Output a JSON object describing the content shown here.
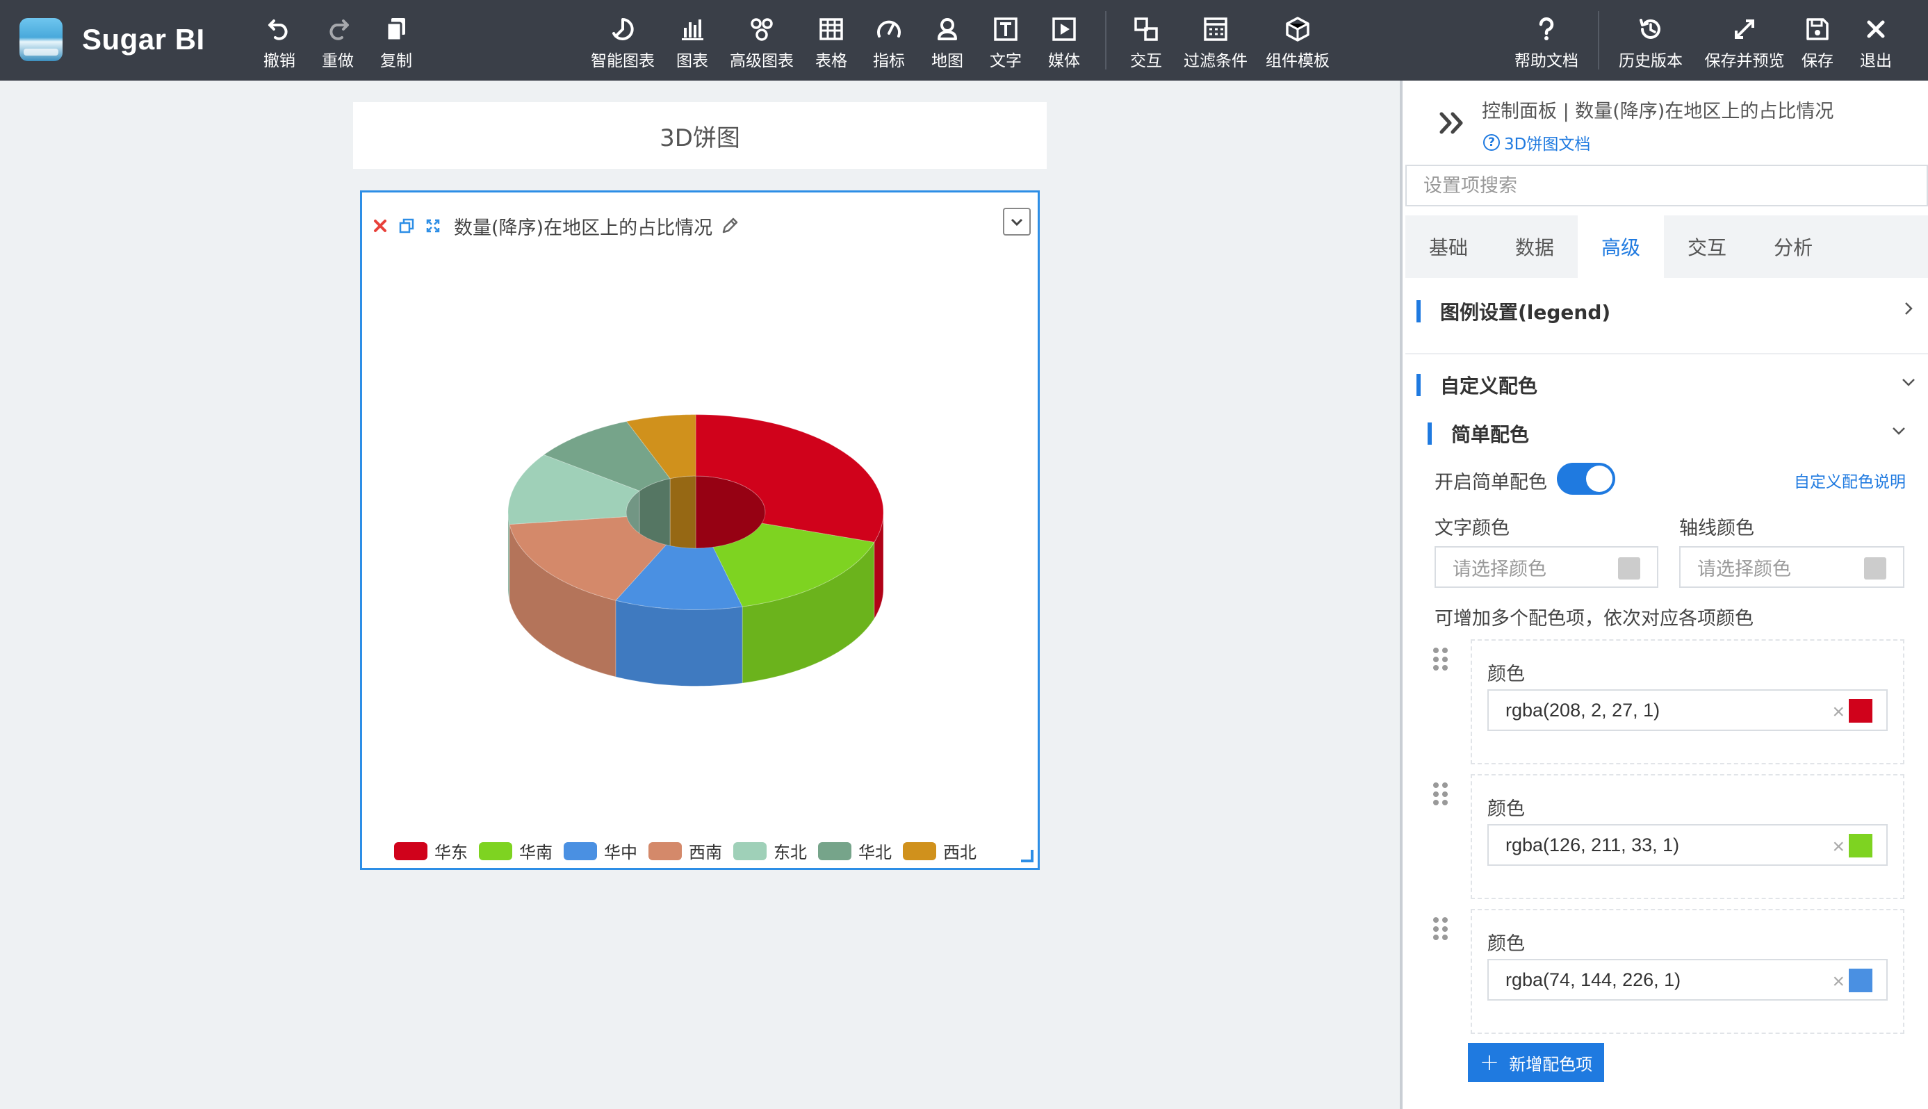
{
  "brand": {
    "name": "Sugar BI"
  },
  "toolbar": {
    "left": [
      {
        "key": "undo",
        "label": "撤销",
        "icon": "undo-icon",
        "disabled": false
      },
      {
        "key": "redo",
        "label": "重做",
        "icon": "redo-icon",
        "disabled": true
      },
      {
        "key": "copy",
        "label": "复制",
        "icon": "copy-icon",
        "disabled": false
      }
    ],
    "center": [
      {
        "key": "smart-chart",
        "label": "智能图表",
        "icon": "smart-chart-icon"
      },
      {
        "key": "chart",
        "label": "图表",
        "icon": "bar-chart-icon"
      },
      {
        "key": "advanced-chart",
        "label": "高级图表",
        "icon": "advanced-chart-icon"
      },
      {
        "key": "table",
        "label": "表格",
        "icon": "table-icon"
      },
      {
        "key": "metric",
        "label": "指标",
        "icon": "gauge-icon"
      },
      {
        "key": "map",
        "label": "地图",
        "icon": "map-pin-icon"
      },
      {
        "key": "text",
        "label": "文字",
        "icon": "text-icon"
      },
      {
        "key": "media",
        "label": "媒体",
        "icon": "media-icon"
      },
      {
        "key": "interaction",
        "label": "交互",
        "icon": "interaction-icon"
      },
      {
        "key": "filter",
        "label": "过滤条件",
        "icon": "filter-icon"
      },
      {
        "key": "template",
        "label": "组件模板",
        "icon": "template-icon"
      }
    ],
    "right": [
      {
        "key": "help",
        "label": "帮助文档",
        "icon": "help-icon"
      },
      {
        "key": "history",
        "label": "历史版本",
        "icon": "history-icon"
      },
      {
        "key": "save-preview",
        "label": "保存并预览",
        "icon": "expand-icon"
      },
      {
        "key": "save",
        "label": "保存",
        "icon": "save-icon"
      },
      {
        "key": "exit",
        "label": "退出",
        "icon": "close-icon"
      }
    ]
  },
  "canvas": {
    "page_title": "3D饼图",
    "widget": {
      "title": "数量(降序)在地区上的占比情况"
    }
  },
  "chart_data": {
    "type": "pie",
    "title": "",
    "categories": [
      "华东",
      "华南",
      "华中",
      "西南",
      "东北",
      "华北",
      "西北"
    ],
    "values": [
      30,
      16,
      11,
      16,
      12,
      9,
      6
    ],
    "colors": [
      "#d0021b",
      "#7ed321",
      "#4a90e2",
      "#d4896a",
      "#9fd0b8",
      "#76a48a",
      "#d0911c"
    ],
    "legend": "bottom",
    "donut": true,
    "three_d": true
  },
  "panel": {
    "breadcrumb": "控制面板 | 数量(降序)在地区上的占比情况",
    "doc_link": "3D饼图文档",
    "search_placeholder": "设置项搜索",
    "tabs": [
      "基础",
      "数据",
      "高级",
      "交互",
      "分析"
    ],
    "active_tab": "高级",
    "legend_section": "图例设置(legend)",
    "custom_color_section": "自定义配色",
    "simple_color_section": "简单配色",
    "enable_simple_color": "开启简单配色",
    "simple_color_enabled": true,
    "custom_color_help": "自定义配色说明",
    "text_color_label": "文字颜色",
    "axis_color_label": "轴线颜色",
    "color_placeholder": "请选择颜色",
    "multi_color_hint": "可增加多个配色项，依次对应各项颜色",
    "color_items": [
      {
        "label": "颜色",
        "value": "rgba(208, 2, 27, 1)",
        "swatch": "#d0021b"
      },
      {
        "label": "颜色",
        "value": "rgba(126, 211, 33, 1)",
        "swatch": "#7ed321"
      },
      {
        "label": "颜色",
        "value": "rgba(74, 144, 226, 1)",
        "swatch": "#4a90e2"
      }
    ],
    "add_color_item": "新增配色项"
  }
}
